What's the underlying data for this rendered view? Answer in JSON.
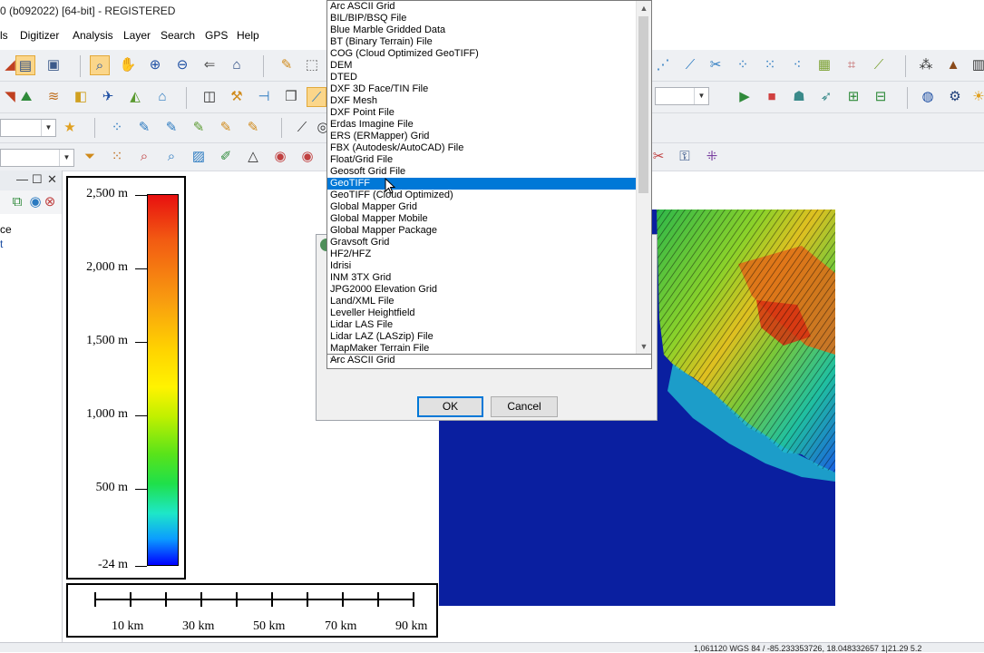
{
  "window": {
    "title": "0 (b092022) [64-bit] - REGISTERED"
  },
  "menu": [
    "ls",
    "Digitizer",
    "Analysis",
    "Layer",
    "Search",
    "GPS",
    "Help"
  ],
  "panel": {
    "items": [
      "ce",
      "t"
    ]
  },
  "legend": {
    "labels": [
      "2,500 m",
      "2,000 m",
      "1,500 m",
      "1,000 m",
      "500 m",
      "-24 m"
    ],
    "colors": [
      "#e81010",
      "#f89a10",
      "#fff300",
      "#59e31a",
      "#1ee7c8",
      "#0000ff"
    ]
  },
  "scalebar": {
    "labels": [
      "10 km",
      "30 km",
      "50 km",
      "70 km",
      "90 km"
    ]
  },
  "dialog": {
    "selected_format": "Arc ASCII Grid",
    "ok_label": "OK",
    "cancel_label": "Cancel"
  },
  "dropdown": {
    "selected_index": 15,
    "items": [
      "Arc ASCII Grid",
      "BIL/BIP/BSQ File",
      "Blue Marble Gridded Data",
      "BT (Binary Terrain) File",
      "COG (Cloud Optimized GeoTIFF)",
      "DEM",
      "DTED",
      "DXF 3D Face/TIN File",
      "DXF Mesh",
      "DXF Point File",
      "Erdas Imagine File",
      "ERS (ERMapper) Grid",
      "FBX (Autodesk/AutoCAD) File",
      "Float/Grid File",
      "Geosoft Grid File",
      "GeoTIFF",
      "GeoTIFF (Cloud Optimized)",
      "Global Mapper Grid",
      "Global Mapper Mobile",
      "Global Mapper Package",
      "Gravsoft Grid",
      "HF2/HFZ",
      "Idrisi",
      "INM 3TX Grid",
      "JPG2000 Elevation Grid",
      "Land/XML File",
      "Leveller Heightfield",
      "Lidar LAS File",
      "Lidar LAZ (LASzip) File",
      "MapMaker Terrain  File"
    ]
  },
  "status": {
    "text": "1,061120   WGS 84 / -85.233353726, 18.048332657   1|21.29 5.2"
  },
  "toolbar_icons": [
    "globe-icon",
    "gear-icon",
    "play-icon",
    "stop-icon",
    "star-icon",
    "filter-icon"
  ]
}
